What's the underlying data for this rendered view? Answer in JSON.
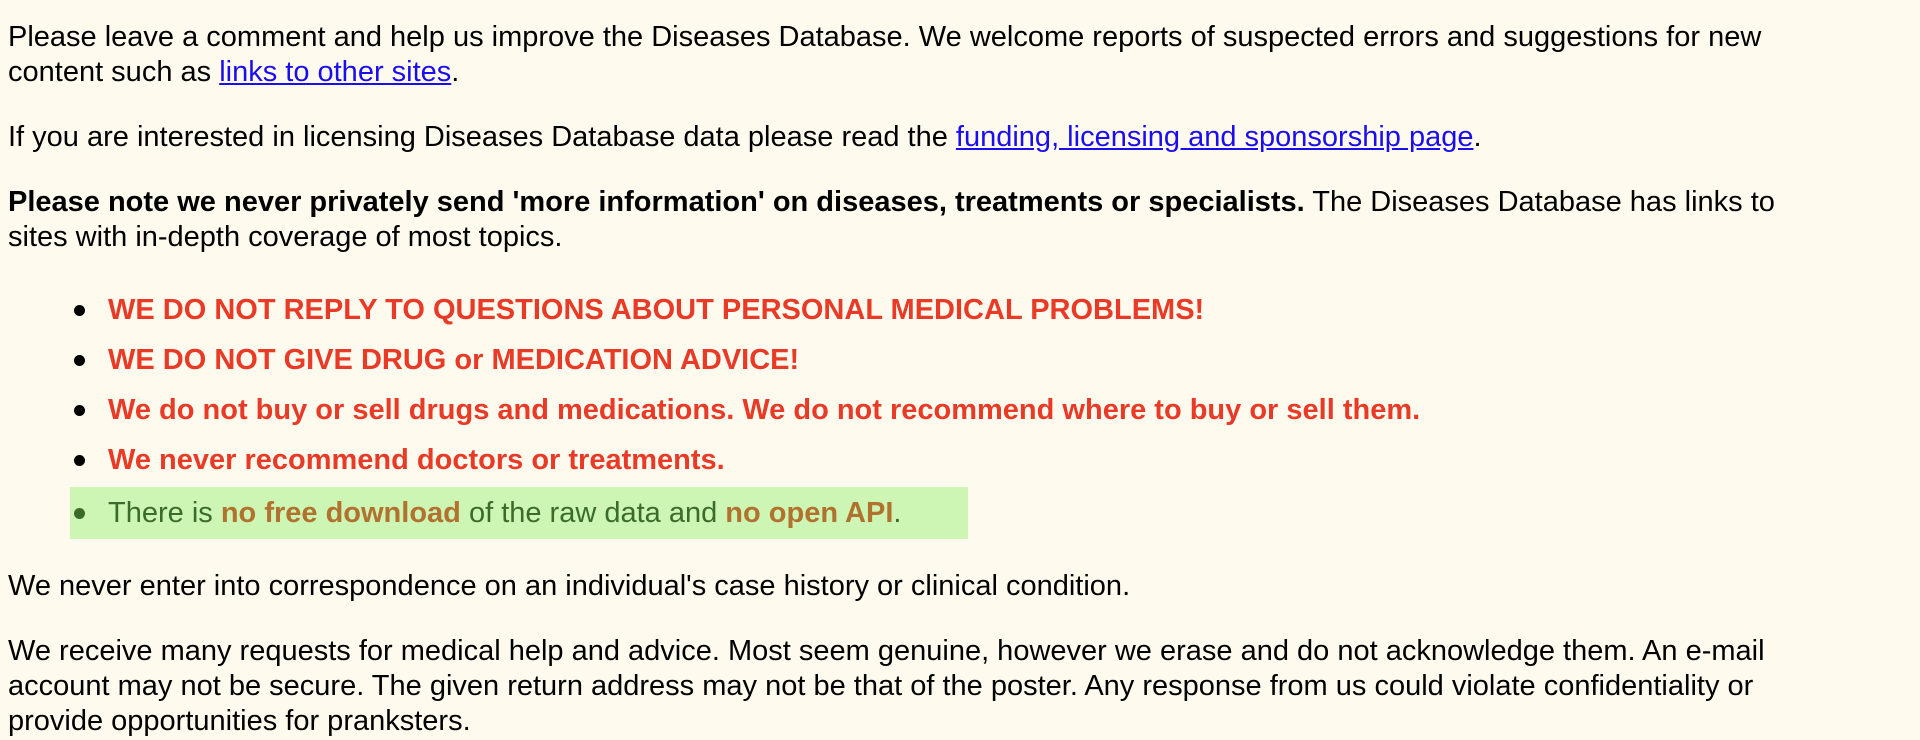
{
  "intro": {
    "text_before": "Please leave a comment and help us improve the Diseases Database. We welcome reports of suspected errors and suggestions for new content such as ",
    "link": "links to other sites",
    "text_after": "."
  },
  "licensing": {
    "text_before": "If you are interested in licensing Diseases Database data please read the ",
    "link": "funding, licensing and sponsorship page",
    "text_after": "."
  },
  "note": {
    "bold": "Please note we never privately send 'more information' on diseases, treatments or specialists.",
    "text": " The Diseases Database has links to sites with in-depth coverage of most topics."
  },
  "warnings": [
    "WE DO NOT REPLY TO QUESTIONS ABOUT PERSONAL MEDICAL PROBLEMS!",
    "WE DO NOT GIVE DRUG or MEDICATION ADVICE!",
    "We do not buy or sell drugs and medications. We do not recommend where to buy or sell them.",
    "We never recommend doctors or treatments."
  ],
  "download_notice": {
    "part1": "There is ",
    "hl1": "no free download",
    "part2": " of the raw data and ",
    "hl2": "no open API",
    "part3": "."
  },
  "correspondence": "We never enter into correspondence on an individual's case history or clinical condition.",
  "requests": "We receive many requests for medical help and advice. Most seem genuine, however we erase and do not acknowledge them. An e-mail account may not be secure. The given return address may not be that of the poster. Any response from us could violate confidentiality or provide opportunities for pranksters.",
  "colors": {
    "background": "#fefbee",
    "link": "#1a0dee",
    "warning": "#e83a26",
    "notice_bg": "#cdf5b3",
    "notice_text": "#3b6b2a",
    "notice_highlight": "#b0722e"
  }
}
